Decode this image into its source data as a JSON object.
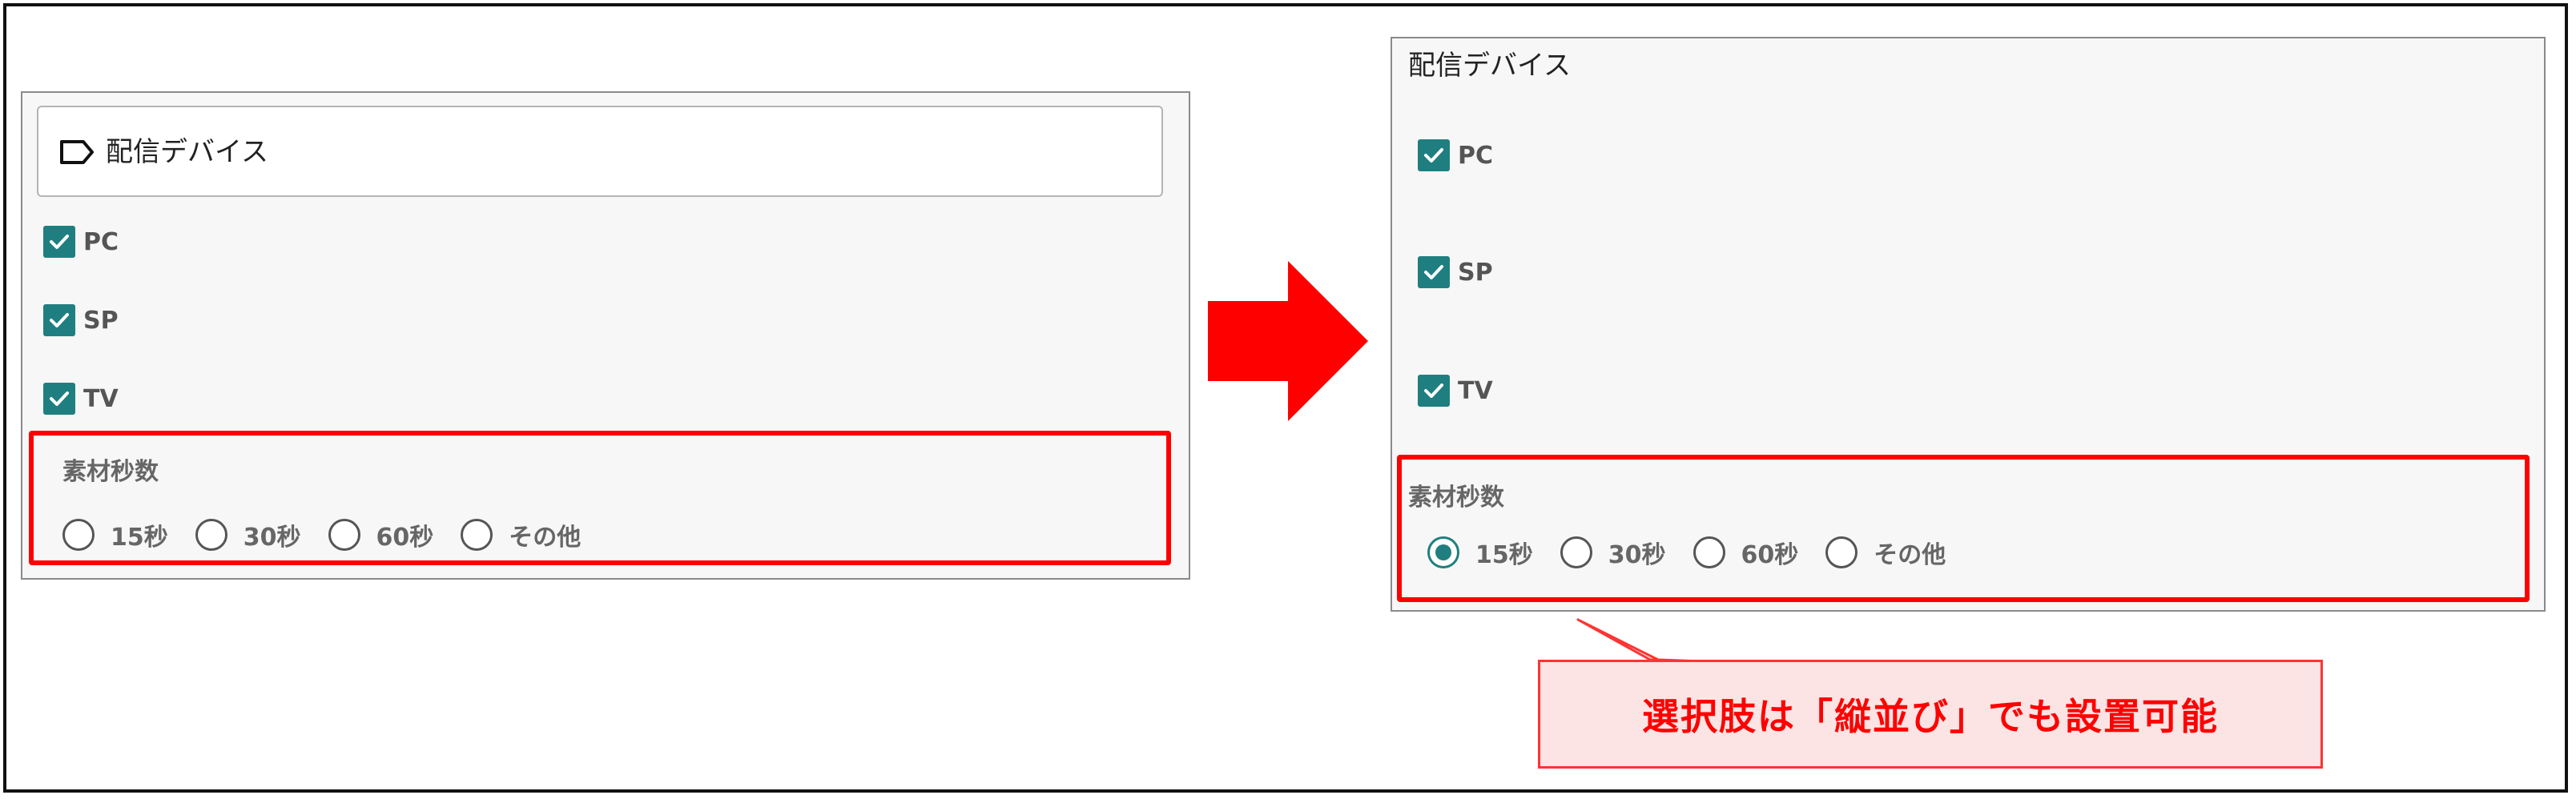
{
  "before": {
    "title": "配信デバイス",
    "devices": [
      {
        "label": "PC",
        "checked": true
      },
      {
        "label": "SP",
        "checked": true
      },
      {
        "label": "TV",
        "checked": true
      }
    ],
    "duration": {
      "label": "素材秒数",
      "options": [
        {
          "label": "15秒",
          "selected": false
        },
        {
          "label": "30秒",
          "selected": false
        },
        {
          "label": "60秒",
          "selected": false
        },
        {
          "label": "その他",
          "selected": false
        }
      ]
    }
  },
  "after": {
    "title": "配信デバイス",
    "devices": [
      {
        "label": "PC",
        "checked": true
      },
      {
        "label": "SP",
        "checked": true
      },
      {
        "label": "TV",
        "checked": true
      }
    ],
    "duration": {
      "label": "素材秒数",
      "options": [
        {
          "label": "15秒",
          "selected": true
        },
        {
          "label": "30秒",
          "selected": false
        },
        {
          "label": "60秒",
          "selected": false
        },
        {
          "label": "その他",
          "selected": false
        }
      ]
    }
  },
  "callout": {
    "text": "選択肢は「縦並び」でも設置可能"
  },
  "colors": {
    "accent": "#1f7f80",
    "highlight": "#ff0000",
    "callout_bg": "#fde4e4"
  }
}
